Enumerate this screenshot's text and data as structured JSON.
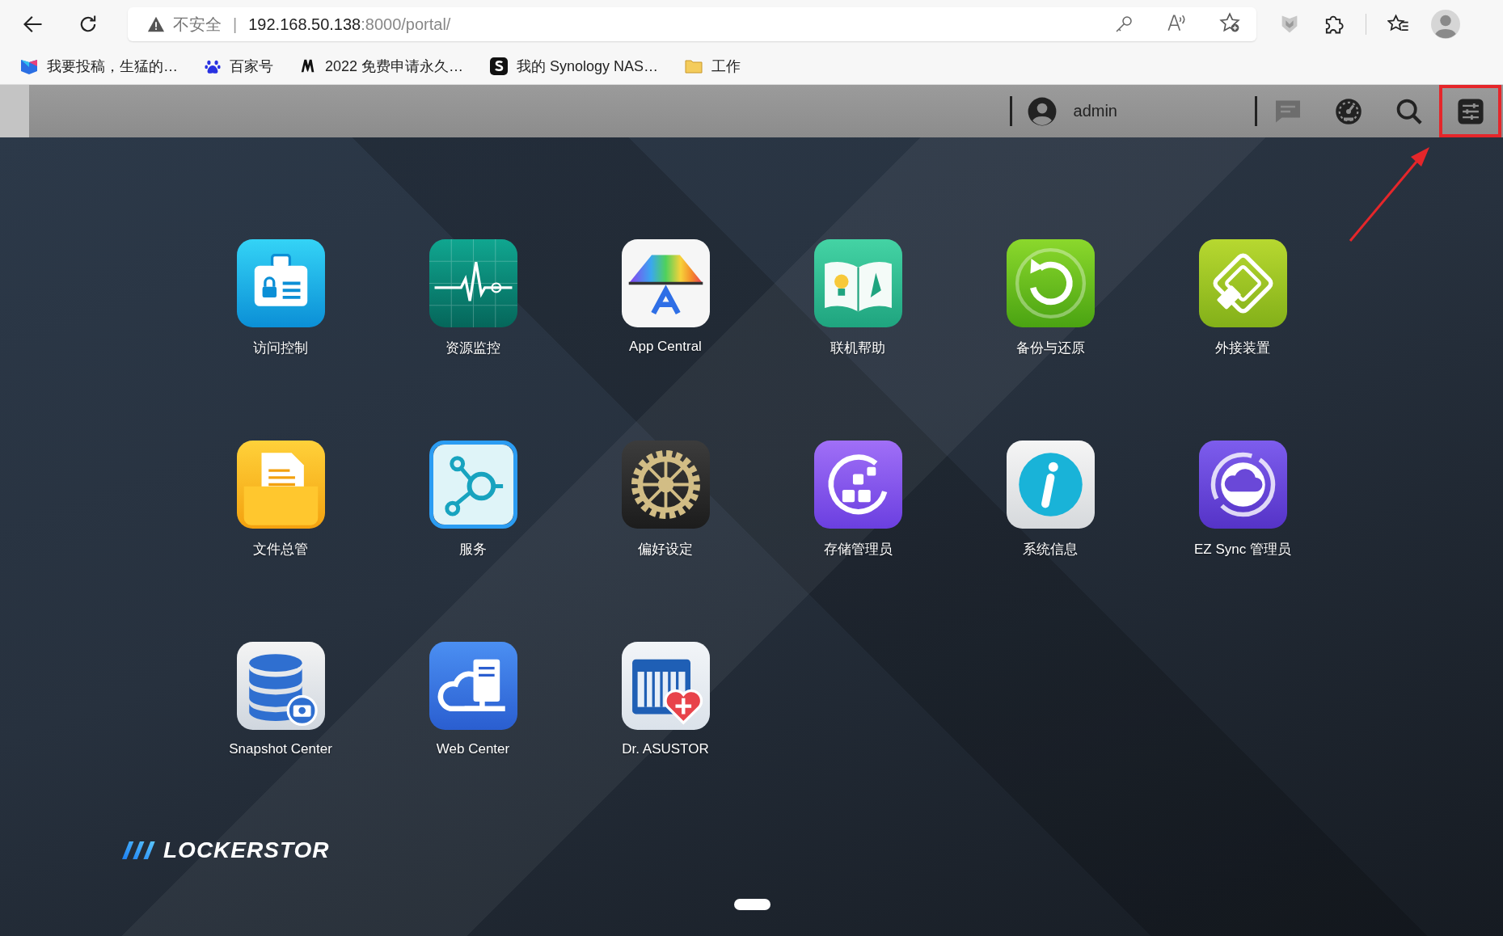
{
  "address_bar": {
    "security_label": "不安全",
    "separator": "|",
    "host": "192.168.50.138",
    "path": ":8000/portal/"
  },
  "bookmarks": [
    {
      "label": "我要投稿，生猛的…",
      "kind": "app"
    },
    {
      "label": "百家号",
      "kind": "paw"
    },
    {
      "label": "2022 免费申请永久…",
      "kind": "mark"
    },
    {
      "label": "我的 Synology NAS…",
      "kind": "square"
    },
    {
      "label": "工作",
      "kind": "folder"
    }
  ],
  "app_bar": {
    "user": "admin",
    "buttons": [
      {
        "kind": "messages",
        "disabled": true,
        "highlighted": false
      },
      {
        "kind": "dashboard",
        "disabled": false,
        "highlighted": false
      },
      {
        "kind": "search",
        "disabled": false,
        "highlighted": false
      },
      {
        "kind": "settings",
        "disabled": false,
        "highlighted": true
      }
    ]
  },
  "apps": [
    {
      "label": "访问控制",
      "kind": "access",
      "selected": false
    },
    {
      "label": "资源监控",
      "kind": "monitor",
      "selected": false
    },
    {
      "label": "App Central",
      "kind": "central",
      "selected": false
    },
    {
      "label": "联机帮助",
      "kind": "help",
      "selected": false
    },
    {
      "label": "备份与还原",
      "kind": "backup",
      "selected": false
    },
    {
      "label": "外接装置",
      "kind": "external",
      "selected": false
    },
    {
      "label": "文件总管",
      "kind": "files",
      "selected": false
    },
    {
      "label": "服务",
      "kind": "services",
      "selected": true
    },
    {
      "label": "偏好设定",
      "kind": "prefs",
      "selected": false
    },
    {
      "label": "存储管理员",
      "kind": "storage",
      "selected": false
    },
    {
      "label": "系统信息",
      "kind": "info",
      "selected": false
    },
    {
      "label": "EZ Sync 管理员",
      "kind": "sync",
      "selected": false
    },
    {
      "label": "Snapshot Center",
      "kind": "snapshot",
      "selected": false
    },
    {
      "label": "Web Center",
      "kind": "web",
      "selected": false
    },
    {
      "label": "Dr. ASUSTOR",
      "kind": "doctor",
      "selected": false
    }
  ],
  "brand": "LOCKERSTOR"
}
